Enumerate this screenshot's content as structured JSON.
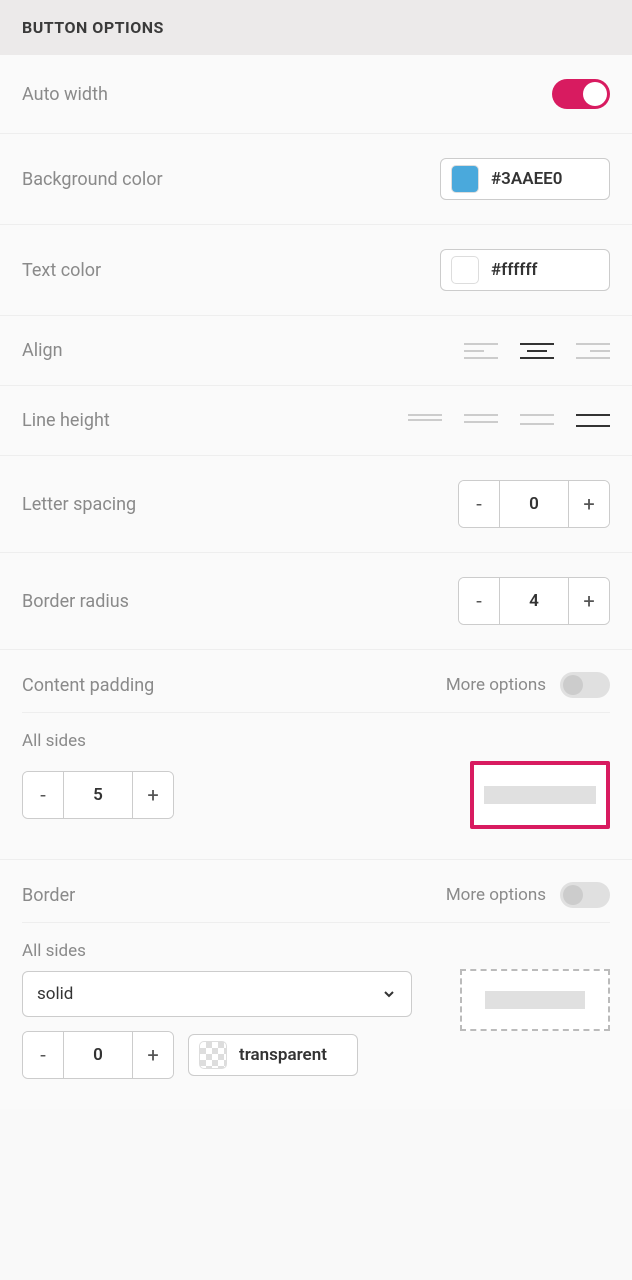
{
  "header": {
    "title": "BUTTON OPTIONS"
  },
  "auto_width": {
    "label": "Auto width",
    "value": true
  },
  "background_color": {
    "label": "Background color",
    "value": "#3AAEE0",
    "swatch": "#4aa9dc"
  },
  "text_color": {
    "label": "Text color",
    "value": "#ffffff",
    "swatch": "#ffffff"
  },
  "align": {
    "label": "Align",
    "options": [
      "left",
      "center",
      "right"
    ],
    "selected": "center"
  },
  "line_height": {
    "label": "Line height",
    "options": [
      "xs",
      "s",
      "m",
      "l"
    ],
    "selected": "l"
  },
  "letter_spacing": {
    "label": "Letter spacing",
    "value": "0"
  },
  "border_radius": {
    "label": "Border radius",
    "value": "4"
  },
  "content_padding": {
    "label": "Content padding",
    "more_label": "More options",
    "more_on": false,
    "all_sides_label": "All sides",
    "all_sides_value": "5"
  },
  "border": {
    "label": "Border",
    "more_label": "More options",
    "more_on": false,
    "all_sides_label": "All sides",
    "style": "solid",
    "width": "0",
    "color_value": "transparent"
  },
  "symbols": {
    "minus": "-",
    "plus": "+"
  }
}
